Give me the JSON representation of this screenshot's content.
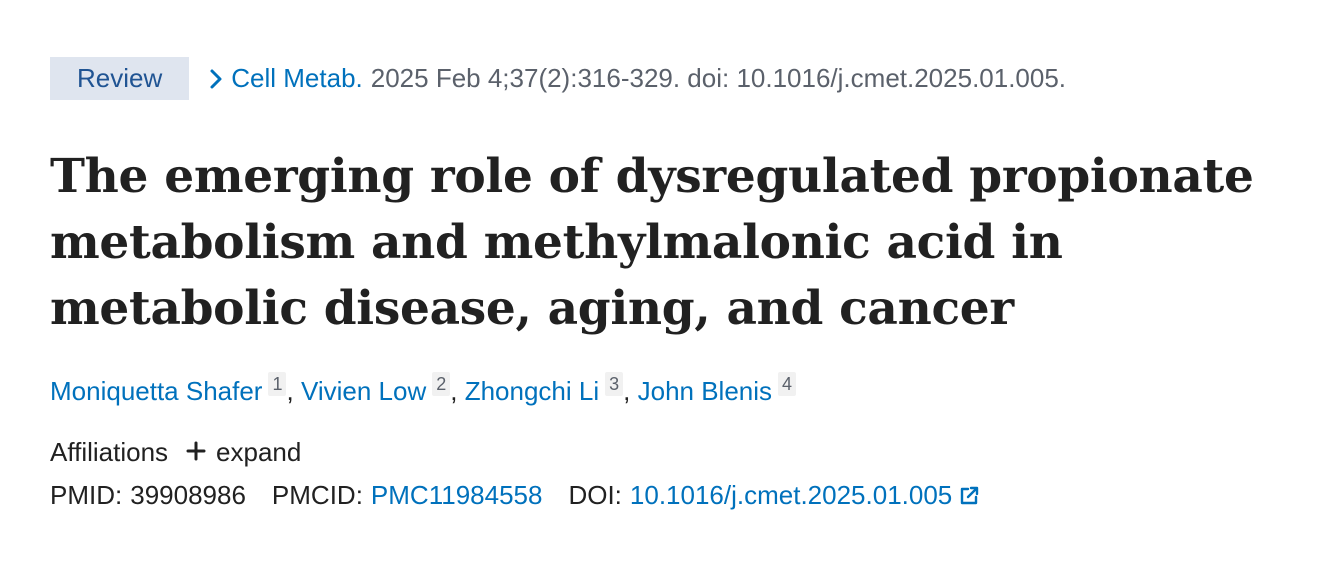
{
  "citation": {
    "type_badge": "Review",
    "journal": "Cell Metab.",
    "details": "2025 Feb 4;37(2):316-329. doi: 10.1016/j.cmet.2025.01.005."
  },
  "title": "The emerging role of dysregulated propionate metabolism and methylmalonic acid in metabolic disease, aging, and cancer",
  "authors": [
    {
      "name": "Moniquetta Shafer",
      "aff": "1"
    },
    {
      "name": "Vivien Low",
      "aff": "2"
    },
    {
      "name": "Zhongchi Li",
      "aff": "3"
    },
    {
      "name": "John Blenis",
      "aff": "4"
    }
  ],
  "author_separator": ",",
  "affiliations": {
    "label": "Affiliations",
    "expand_label": "expand",
    "expand_icon": "plus-icon"
  },
  "identifiers": {
    "pmid_label": "PMID:",
    "pmid": "39908986",
    "pmcid_label": "PMCID:",
    "pmcid": "PMC11984558",
    "doi_label": "DOI:",
    "doi": "10.1016/j.cmet.2025.01.005",
    "doi_icon": "external-link-icon"
  },
  "colors": {
    "link": "#0071bc",
    "badge_bg": "#dfe5ef",
    "badge_text": "#205493",
    "text": "#212121",
    "muted": "#5b616b"
  }
}
